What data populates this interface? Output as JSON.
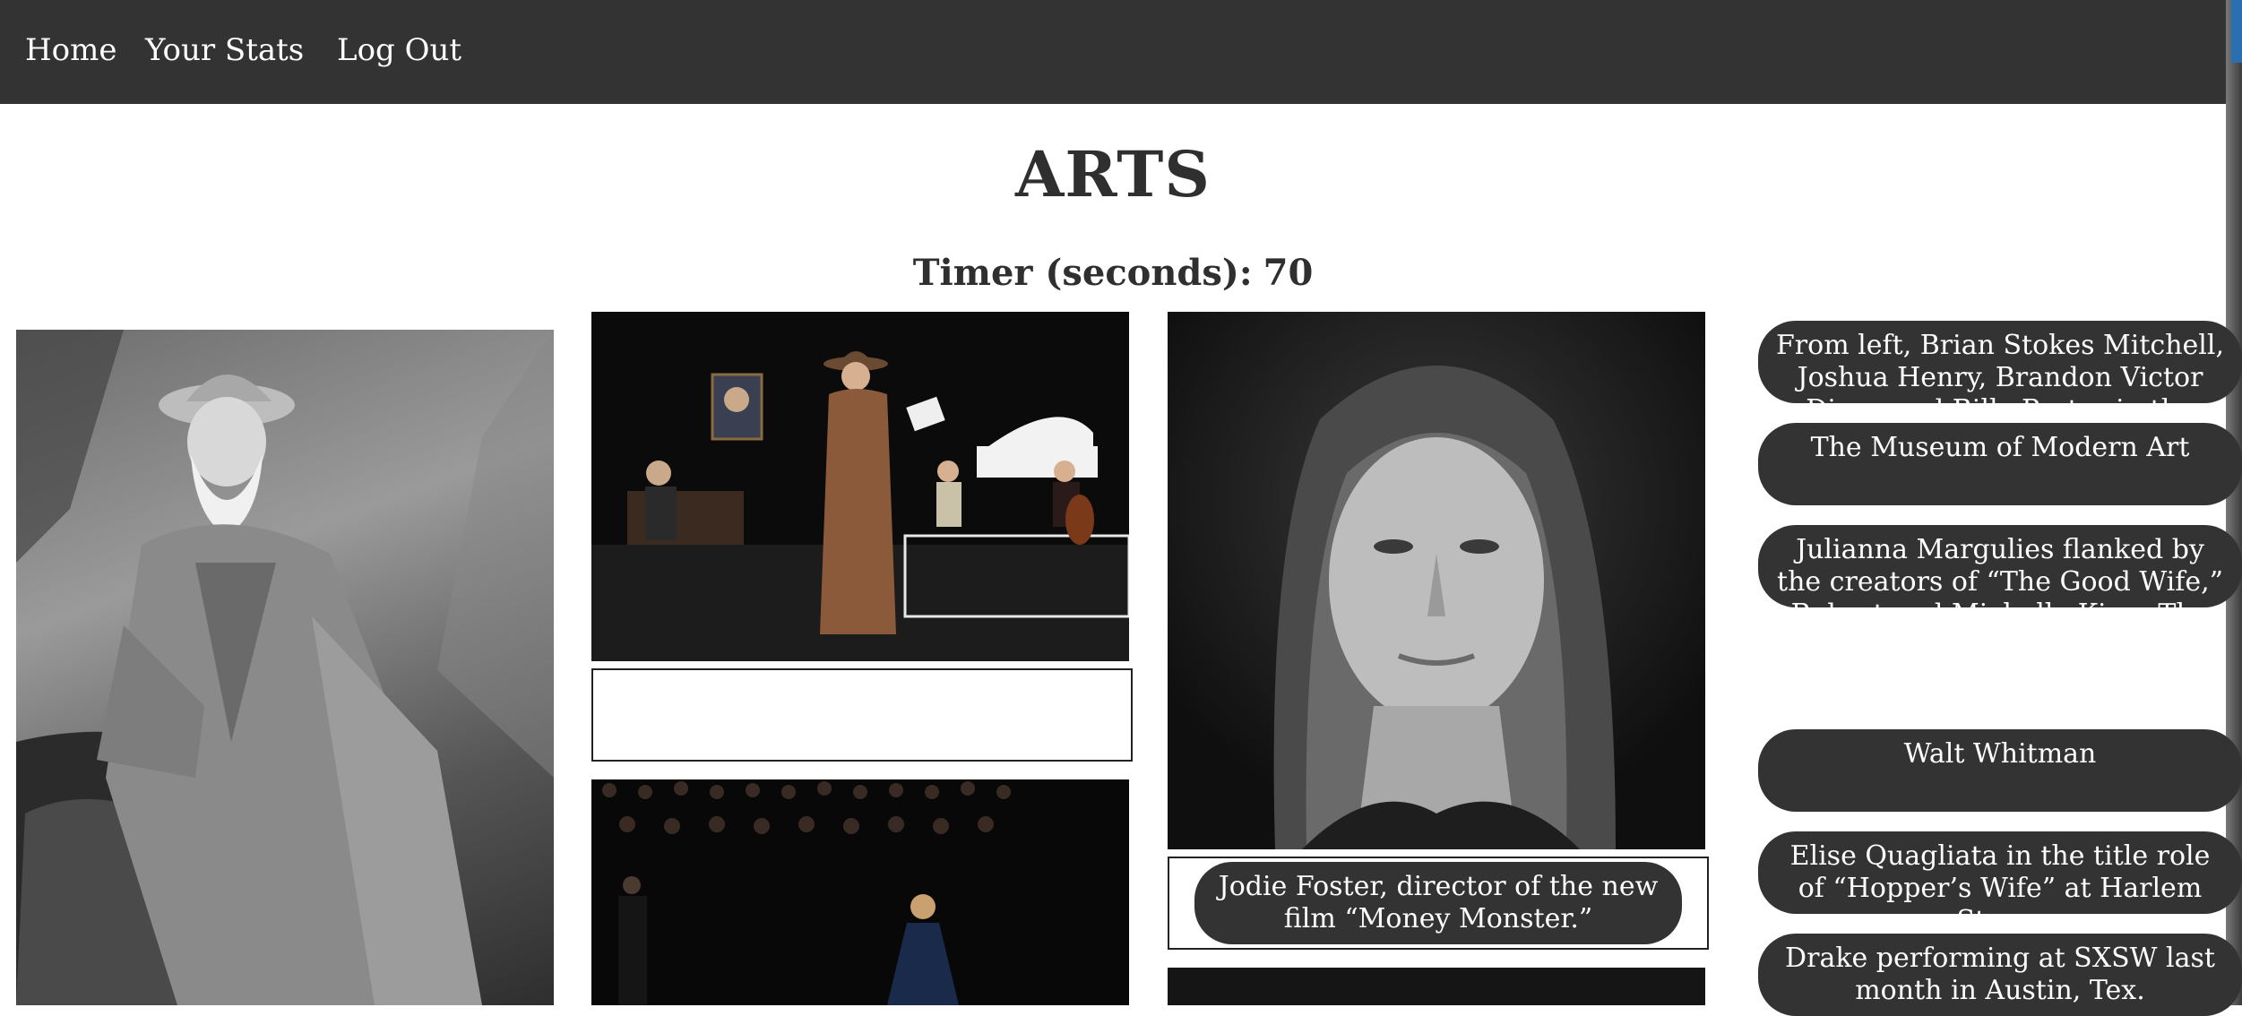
{
  "nav": {
    "home": "Home",
    "stats": "Your Stats",
    "logout": "Log Out"
  },
  "title": "ARTS",
  "timer": {
    "label": "Timer (seconds):",
    "value": "70"
  },
  "photos": [
    {
      "subject": "Elderly bearded man in hat seated on rock (black and white)"
    },
    {
      "subject": "Stage play with actors reading, piano and cello"
    },
    {
      "subject": "Black and white portrait of a woman"
    },
    {
      "subject": "Choir on dark stage with soloist in blue dress"
    },
    {
      "subject": "Dark image (partially visible)"
    }
  ],
  "placed_caption": "Jodie Foster, director of the new film “Money Monster.”",
  "captions": [
    "From left, Brian Stokes Mitchell, Joshua Henry, Brandon Victor Dixon and Billy Porter in the",
    "The Museum of Modern Art",
    "Julianna Margulies flanked by the creators of “The Good Wife,” Robert and Michelle King. The CBS",
    "Walt Whitman",
    "Elise Quagliata in the title role of “Hopper’s Wife” at Harlem Stage.",
    "Drake performing at SXSW last month in Austin, Tex."
  ]
}
